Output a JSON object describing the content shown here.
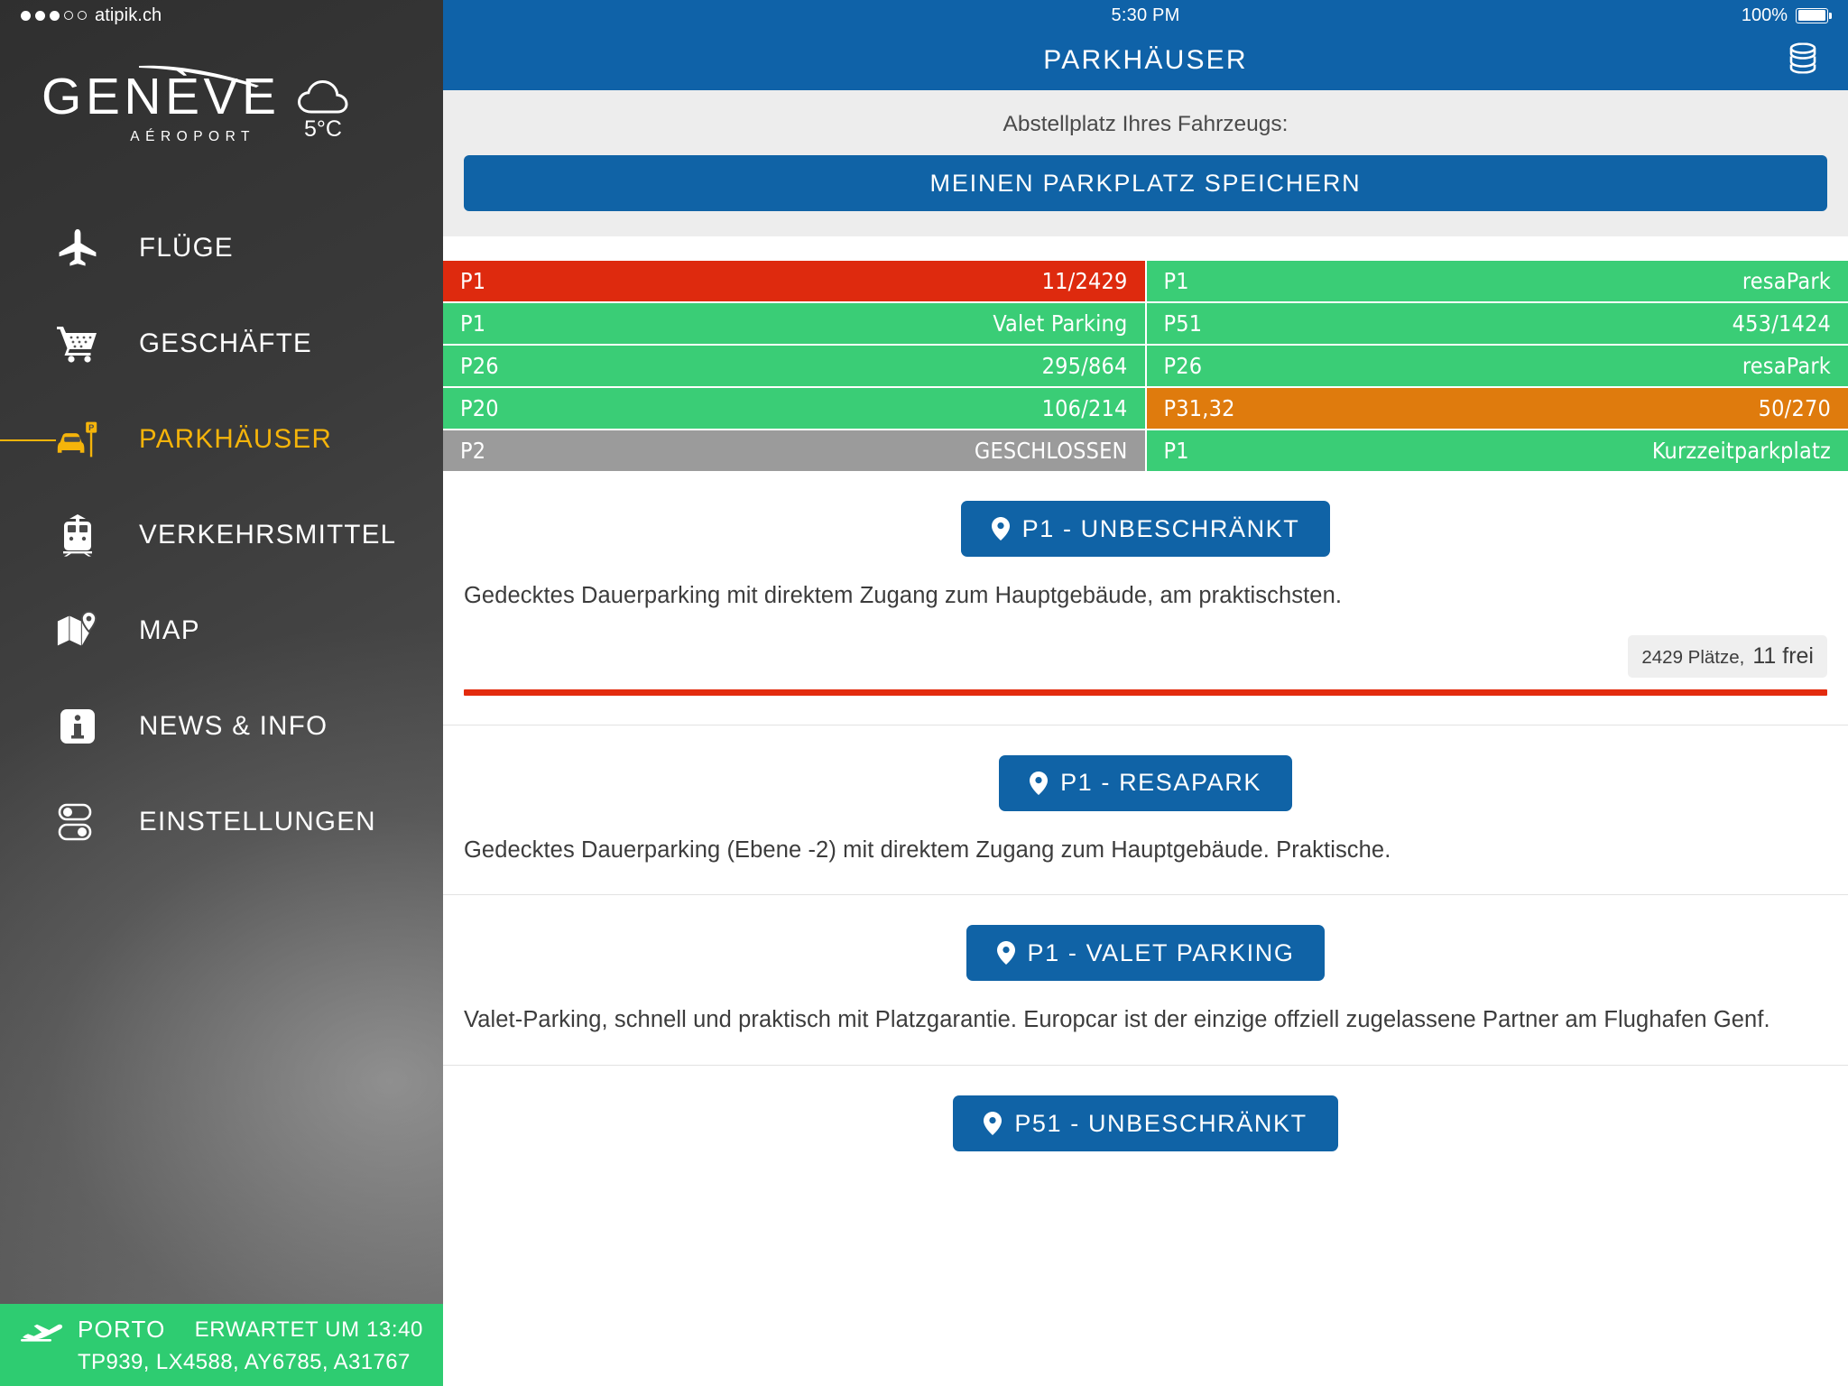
{
  "sidebar": {
    "status": {
      "carrier": "atipik.ch",
      "signal_filled": 3,
      "signal_total": 5
    },
    "logo": {
      "main": "GENÈVE",
      "sub": "AÉROPORT"
    },
    "weather": {
      "temperature": "5°C",
      "icon": "cloud-icon"
    },
    "nav": [
      {
        "label": "FLÜGE",
        "icon": "airplane-icon",
        "active": false
      },
      {
        "label": "GESCHÄFTE",
        "icon": "shopping-cart-icon",
        "active": false
      },
      {
        "label": "PARKHÄUSER",
        "icon": "parking-car-icon",
        "active": true
      },
      {
        "label": "VERKEHRSMITTEL",
        "icon": "tram-icon",
        "active": false
      },
      {
        "label": "MAP",
        "icon": "map-pin-icon",
        "active": false
      },
      {
        "label": "NEWS & INFO",
        "icon": "info-icon",
        "active": false
      },
      {
        "label": "EINSTELLUNGEN",
        "icon": "settings-toggles-icon",
        "active": false
      }
    ],
    "flight_banner": {
      "icon": "airplane-takeoff-icon",
      "destination": "PORTO",
      "eta": "ERWARTET UM 13:40",
      "flight_numbers": "TP939, LX4588, AY6785, A31767"
    }
  },
  "main": {
    "status": {
      "time": "5:30 PM",
      "battery_percent": "100%"
    },
    "header": {
      "title": "PARKHÄUSER",
      "action_icon": "stacked-coins-icon"
    },
    "save_panel": {
      "label": "Abstellplatz Ihres Fahrzeugs:",
      "button": "MEINEN PARKPLATZ SPEICHERN"
    },
    "grid": [
      {
        "name": "P1",
        "value": "11/2429",
        "status": "red"
      },
      {
        "name": "P1",
        "value": "resaPark",
        "status": "green"
      },
      {
        "name": "P1",
        "value": "Valet Parking",
        "status": "green"
      },
      {
        "name": "P51",
        "value": "453/1424",
        "status": "green"
      },
      {
        "name": "P26",
        "value": "295/864",
        "status": "green"
      },
      {
        "name": "P26",
        "value": "resaPark",
        "status": "green"
      },
      {
        "name": "P20",
        "value": "106/214",
        "status": "green"
      },
      {
        "name": "P31,32",
        "value": "50/270",
        "status": "orange"
      },
      {
        "name": "P2",
        "value": "GESCHLOSSEN",
        "status": "grey"
      },
      {
        "name": "P1",
        "value": "Kurzzeitparkplatz",
        "status": "green"
      }
    ],
    "lots": [
      {
        "button": "P1 - UNBESCHRÄNKT",
        "icon": "map-pin-icon",
        "description": "Gedecktes Dauerparking mit direktem Zugang zum Hauptgebäude, am praktischsten.",
        "has_availability": true,
        "total_text": "2429 Plätze,",
        "free_text": "11 frei",
        "fill_percent": 100,
        "bar_color": "#E32B0E"
      },
      {
        "button": "P1 - RESAPARK",
        "icon": "map-pin-icon",
        "description": "Gedecktes Dauerparking (Ebene -2) mit direktem Zugang zum Hauptgebäude. Praktische.",
        "has_availability": false
      },
      {
        "button": "P1 - VALET PARKING",
        "icon": "map-pin-icon",
        "description": "Valet-Parking, schnell und praktisch mit Platzgarantie. Europcar ist der einzige offziell zugelassene Partner am Flughafen Genf.",
        "has_availability": false
      },
      {
        "button": "P51 - UNBESCHRÄNKT",
        "icon": "map-pin-icon",
        "description": "",
        "has_availability": false
      }
    ]
  },
  "colors": {
    "brand_blue": "#1063A6",
    "status_bar_blue": "#0F62A8",
    "accent_gold": "#F5B40A",
    "status_green": "#3ACD76",
    "status_red": "#DE2A0E",
    "status_orange": "#DF7B0D",
    "status_grey": "#9B9B9B",
    "banner_green": "#2ECC71"
  }
}
